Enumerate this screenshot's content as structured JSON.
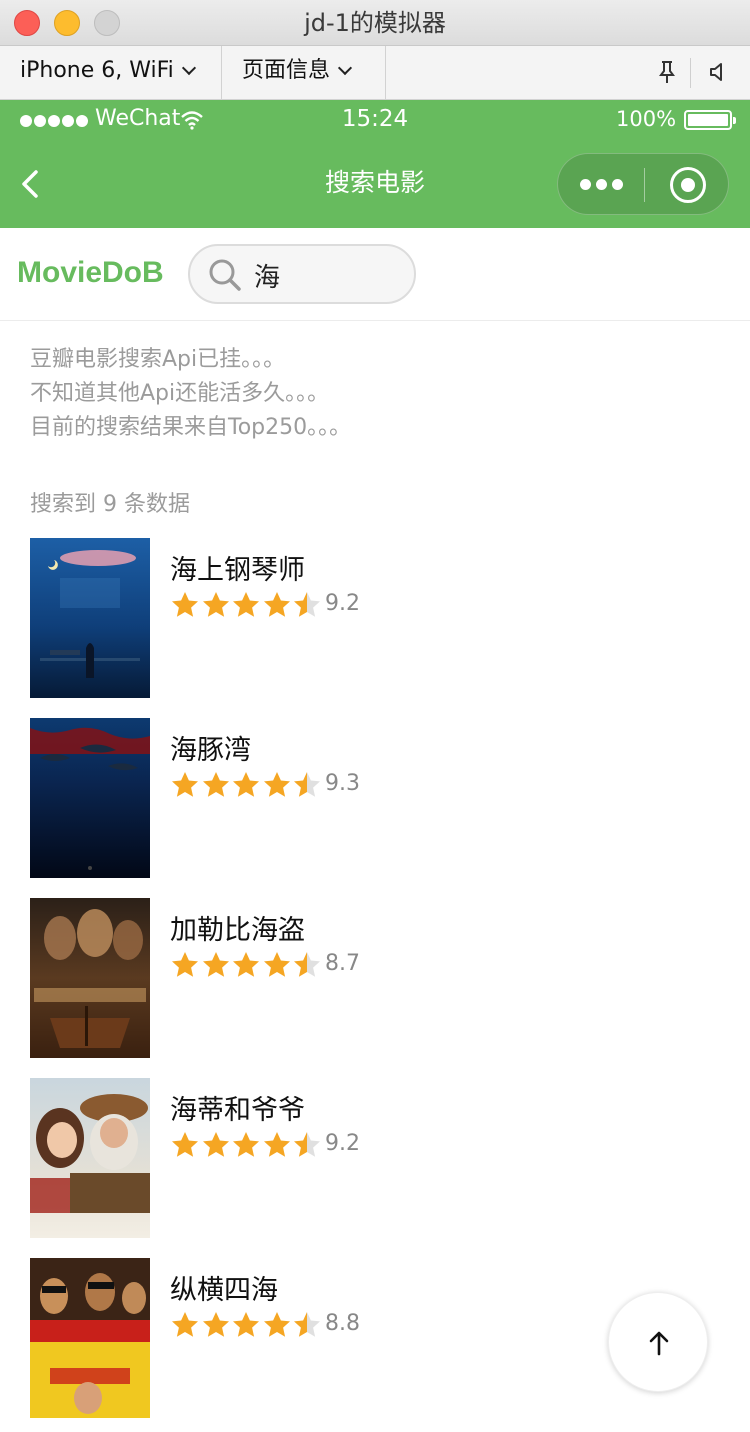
{
  "window": {
    "title": "jd-1的模拟器"
  },
  "toolbar": {
    "device": "iPhone 6, WiFi",
    "page_info": "页面信息"
  },
  "status_bar": {
    "carrier": "WeChat",
    "time": "15:24",
    "battery": "100%"
  },
  "nav": {
    "title": "搜索电影"
  },
  "header": {
    "brand": "MovieDoB",
    "search_value": "海"
  },
  "notice": [
    "豆瓣电影搜索Api已挂。。。",
    "不知道其他Api还能活多久。。。",
    "目前的搜索结果来自Top250。。。"
  ],
  "result_count": "搜索到 9 条数据",
  "colors": {
    "accent": "#67bb5e",
    "star": "#f5a623",
    "star_empty": "#e0e0e0"
  },
  "movies": [
    {
      "title": "海上钢琴师",
      "rating": "9.2",
      "stars": 4.5
    },
    {
      "title": "海豚湾",
      "rating": "9.3",
      "stars": 4.5
    },
    {
      "title": "加勒比海盗",
      "rating": "8.7",
      "stars": 4.5
    },
    {
      "title": "海蒂和爷爷",
      "rating": "9.2",
      "stars": 4.5
    },
    {
      "title": "纵横四海",
      "rating": "8.8",
      "stars": 4.5
    }
  ]
}
